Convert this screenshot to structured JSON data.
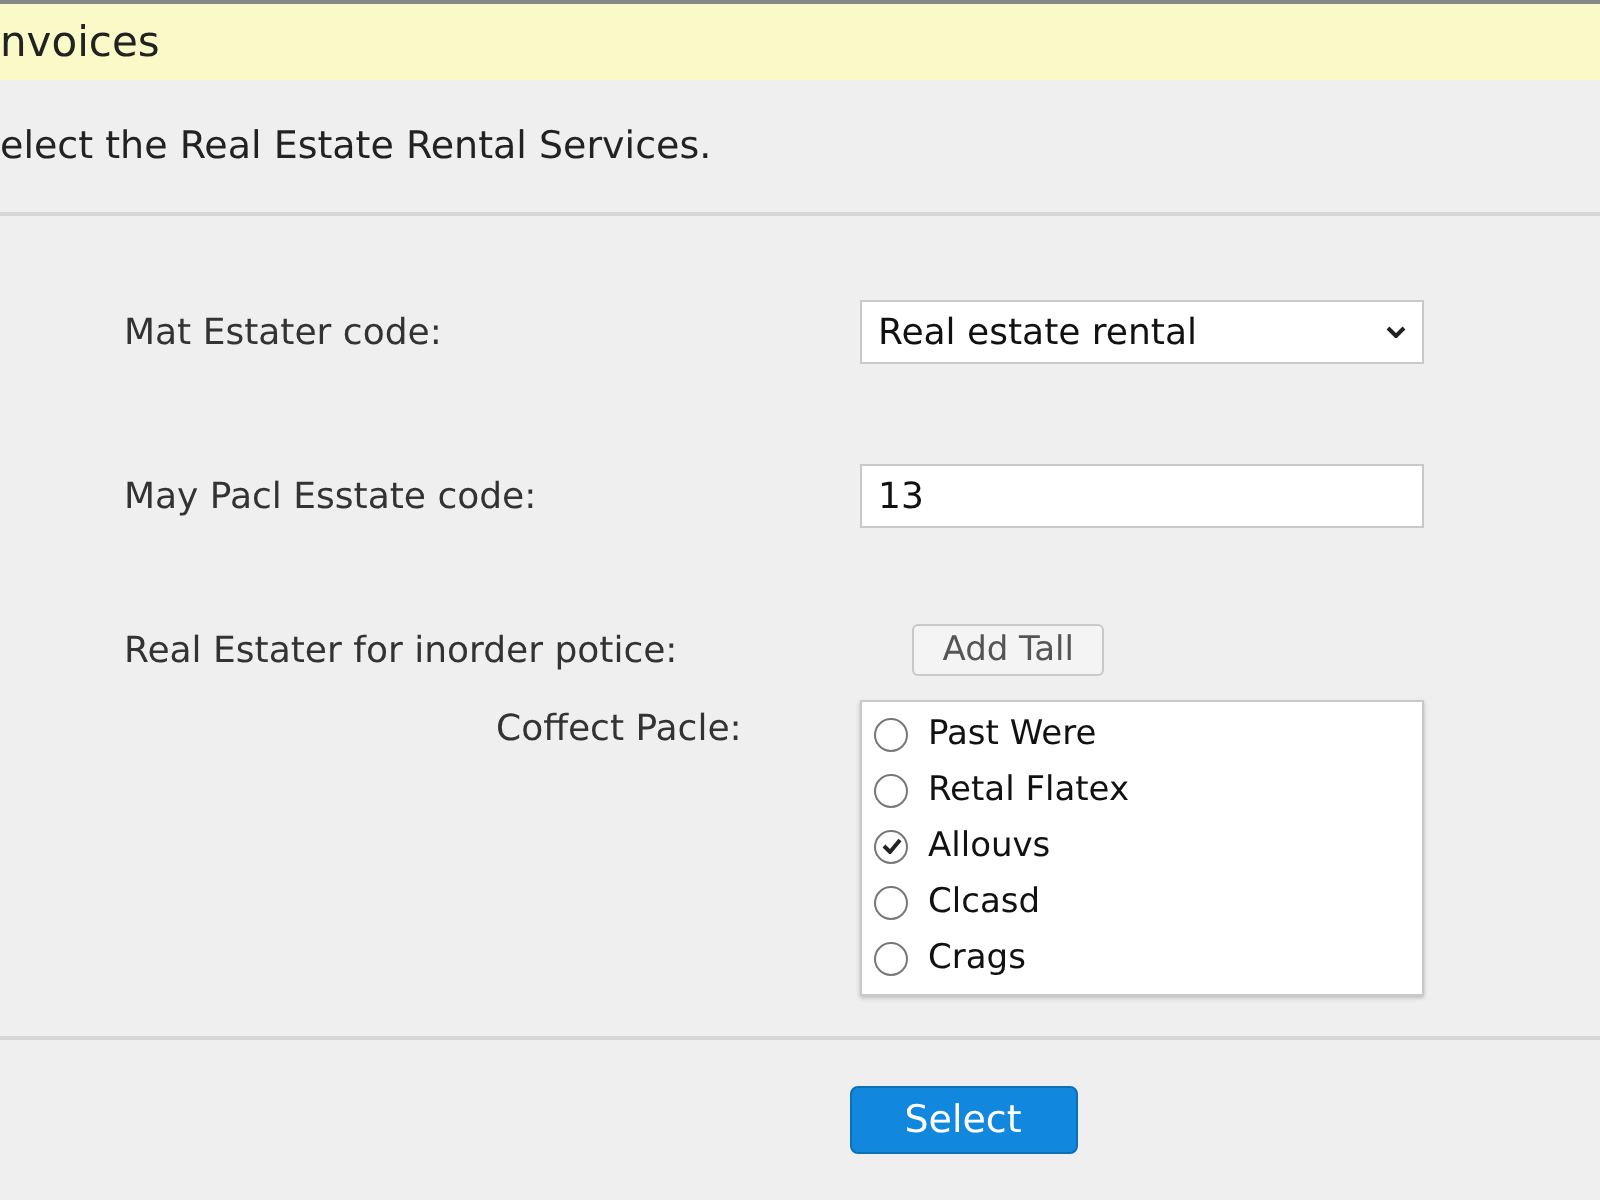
{
  "window": {
    "title": "nvoices"
  },
  "instruction": "elect the Real Estate Rental Services.",
  "fields": [
    {
      "kind": "dropdown",
      "label": "Mat Estater code:",
      "value": "Real estate rental"
    },
    {
      "kind": "text",
      "label": "May Pacl Esstate code:",
      "value": "13"
    },
    {
      "kind": "button",
      "label": "Real Estater for inorder potice:",
      "value": "Add Tall"
    }
  ],
  "options": {
    "label": "Coffect Pacle:",
    "items": [
      {
        "label": "Past Were",
        "selected": false
      },
      {
        "label": "Retal Flatex",
        "selected": false
      },
      {
        "label": "Allouvs",
        "selected": true
      },
      {
        "label": "Clcasd",
        "selected": false
      },
      {
        "label": "Crags",
        "selected": false
      }
    ]
  },
  "buttons": [
    "Select"
  ]
}
